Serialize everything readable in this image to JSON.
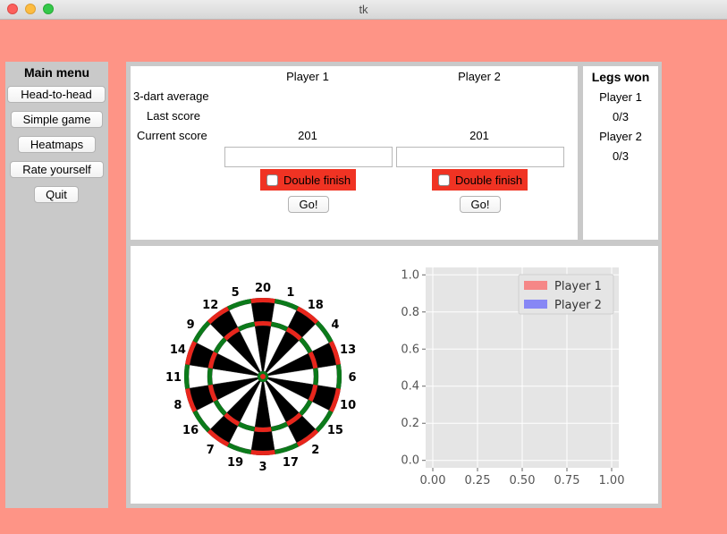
{
  "window": {
    "title": "tk"
  },
  "menu": {
    "title": "Main menu",
    "items": [
      "Head-to-head",
      "Simple game",
      "Heatmaps",
      "Rate yourself",
      "Quit"
    ]
  },
  "scoreboard": {
    "player1": "Player 1",
    "player2": "Player 2",
    "row_labels": [
      "3-dart average",
      "Last score",
      "Current score"
    ],
    "p1_current": "201",
    "p2_current": "201",
    "p1_entry": "",
    "p2_entry": "",
    "double_finish": "Double finish",
    "go": "Go!"
  },
  "legs": {
    "title": "Legs won",
    "player1": "Player 1",
    "p1_legs": "0/3",
    "player2": "Player 2",
    "p2_legs": "0/3"
  },
  "dartboard": {
    "numbers": [
      "20",
      "1",
      "18",
      "4",
      "13",
      "6",
      "10",
      "15",
      "2",
      "17",
      "3",
      "19",
      "7",
      "16",
      "8",
      "11",
      "14",
      "9",
      "12",
      "5"
    ]
  },
  "chart_data": {
    "type": "bar",
    "series": [
      {
        "name": "Player 1",
        "color": "#f58787",
        "values": []
      },
      {
        "name": "Player 2",
        "color": "#8787f5",
        "values": []
      }
    ],
    "xlim": [
      -0.04,
      1.04
    ],
    "ylim": [
      -0.04,
      1.04
    ],
    "xticks": [
      "0.00",
      "0.25",
      "0.50",
      "0.75",
      "1.00"
    ],
    "yticks": [
      "0.0",
      "0.2",
      "0.4",
      "0.6",
      "0.8",
      "1.0"
    ],
    "grid": true,
    "legend": "top-right"
  }
}
